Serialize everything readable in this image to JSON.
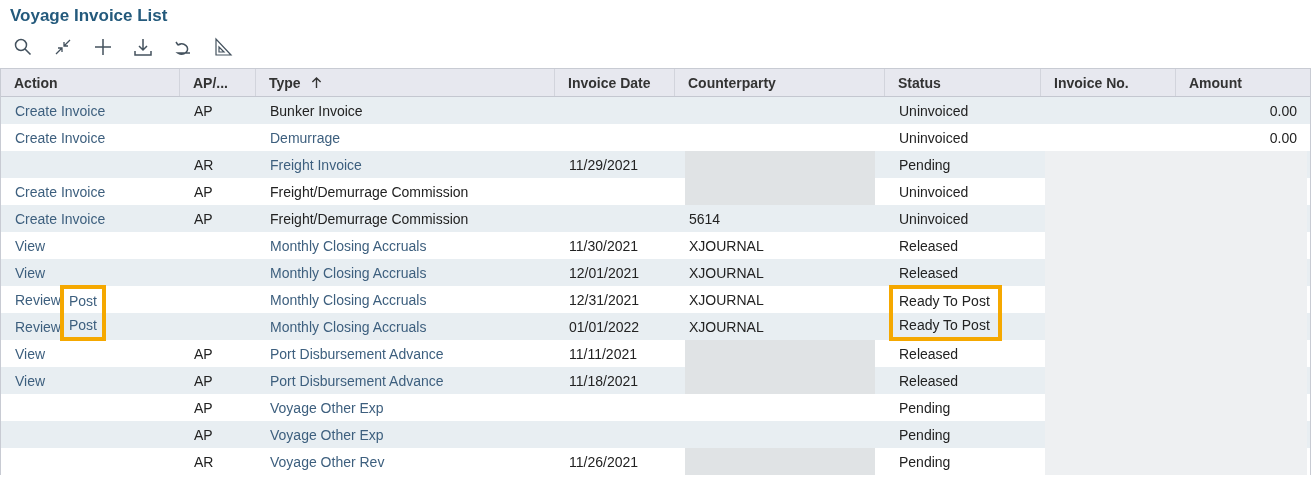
{
  "title": "Voyage Invoice List",
  "toolbar": [
    {
      "kind": "search"
    },
    {
      "kind": "collapse"
    },
    {
      "kind": "add"
    },
    {
      "kind": "download"
    },
    {
      "kind": "undo"
    },
    {
      "kind": "ruler"
    }
  ],
  "columns": [
    {
      "label": "Action",
      "sorted": false
    },
    {
      "label": "AP/...",
      "sorted": false
    },
    {
      "label": "Type",
      "sorted": true
    },
    {
      "label": "Invoice Date",
      "sorted": false
    },
    {
      "label": "Counterparty",
      "sorted": false
    },
    {
      "label": "Status",
      "sorted": false
    },
    {
      "label": "Invoice No.",
      "sorted": false
    },
    {
      "label": "Amount",
      "sorted": false
    }
  ],
  "rows": [
    {
      "actions": [
        "Create Invoice"
      ],
      "ap_ar": "AP",
      "type": "Bunker Invoice",
      "type_link": false,
      "date": "",
      "counterparty": "",
      "counterparty_hidden": false,
      "status": "Uninvoiced",
      "status_highlighted": false,
      "post_highlighted": false,
      "amount": "0.00",
      "number_hidden": false
    },
    {
      "actions": [
        "Create Invoice"
      ],
      "ap_ar": "",
      "type": "Demurrage",
      "type_link": true,
      "date": "",
      "counterparty": "",
      "counterparty_hidden": false,
      "status": "Uninvoiced",
      "status_highlighted": false,
      "post_highlighted": false,
      "amount": "0.00",
      "number_hidden": false
    },
    {
      "actions": [],
      "ap_ar": "AR",
      "type": "Freight Invoice",
      "type_link": true,
      "date": "11/29/2021",
      "counterparty": "",
      "counterparty_hidden": true,
      "status": "Pending",
      "status_highlighted": false,
      "post_highlighted": false,
      "amount": "",
      "number_hidden": true
    },
    {
      "actions": [
        "Create Invoice"
      ],
      "ap_ar": "AP",
      "type": "Freight/Demurrage Commission",
      "type_link": false,
      "date": "",
      "counterparty": "",
      "counterparty_hidden": true,
      "status": "Uninvoiced",
      "status_highlighted": false,
      "post_highlighted": false,
      "amount": "",
      "number_hidden": true
    },
    {
      "actions": [
        "Create Invoice"
      ],
      "ap_ar": "AP",
      "type": "Freight/Demurrage Commission",
      "type_link": false,
      "date": "",
      "counterparty": "5614",
      "counterparty_hidden": false,
      "status": "Uninvoiced",
      "status_highlighted": false,
      "post_highlighted": false,
      "amount": "",
      "number_hidden": true
    },
    {
      "actions": [
        "View"
      ],
      "ap_ar": "",
      "type": "Monthly Closing Accruals",
      "type_link": true,
      "date": "11/30/2021",
      "counterparty": "XJOURNAL",
      "counterparty_hidden": false,
      "status": "Released",
      "status_highlighted": false,
      "post_highlighted": false,
      "amount": "",
      "number_hidden": true
    },
    {
      "actions": [
        "View"
      ],
      "ap_ar": "",
      "type": "Monthly Closing Accruals",
      "type_link": true,
      "date": "12/01/2021",
      "counterparty": "XJOURNAL",
      "counterparty_hidden": false,
      "status": "Released",
      "status_highlighted": false,
      "post_highlighted": false,
      "amount": "",
      "number_hidden": true
    },
    {
      "actions": [
        "Review",
        "Post"
      ],
      "ap_ar": "",
      "type": "Monthly Closing Accruals",
      "type_link": true,
      "date": "12/31/2021",
      "counterparty": "XJOURNAL",
      "counterparty_hidden": false,
      "status": "Ready To Post",
      "status_highlighted": true,
      "post_highlighted": true,
      "amount": "",
      "number_hidden": true
    },
    {
      "actions": [
        "Review",
        "Post"
      ],
      "ap_ar": "",
      "type": "Monthly Closing Accruals",
      "type_link": true,
      "date": "01/01/2022",
      "counterparty": "XJOURNAL",
      "counterparty_hidden": false,
      "status": "Ready To Post",
      "status_highlighted": true,
      "post_highlighted": true,
      "amount": "",
      "number_hidden": true
    },
    {
      "actions": [
        "View"
      ],
      "ap_ar": "AP",
      "type": "Port Disbursement Advance",
      "type_link": true,
      "date": "11/11/2021",
      "counterparty": "",
      "counterparty_hidden": true,
      "status": "Released",
      "status_highlighted": false,
      "post_highlighted": false,
      "amount": "",
      "number_hidden": true
    },
    {
      "actions": [
        "View"
      ],
      "ap_ar": "AP",
      "type": "Port Disbursement Advance",
      "type_link": true,
      "date": "11/18/2021",
      "counterparty": "",
      "counterparty_hidden": true,
      "status": "Released",
      "status_highlighted": false,
      "post_highlighted": false,
      "amount": "",
      "number_hidden": true
    },
    {
      "actions": [],
      "ap_ar": "AP",
      "type": "Voyage Other Exp",
      "type_link": true,
      "date": "",
      "counterparty": "",
      "counterparty_hidden": false,
      "status": "Pending",
      "status_highlighted": false,
      "post_highlighted": false,
      "amount": "",
      "number_hidden": true
    },
    {
      "actions": [],
      "ap_ar": "AP",
      "type": "Voyage Other Exp",
      "type_link": true,
      "date": "",
      "counterparty": "",
      "counterparty_hidden": false,
      "status": "Pending",
      "status_highlighted": false,
      "post_highlighted": false,
      "amount": "",
      "number_hidden": true
    },
    {
      "actions": [],
      "ap_ar": "AR",
      "type": "Voyage Other Rev",
      "type_link": true,
      "date": "11/26/2021",
      "counterparty": "",
      "counterparty_hidden": true,
      "status": "Pending",
      "status_highlighted": false,
      "post_highlighted": false,
      "amount": "",
      "number_hidden": true
    }
  ]
}
